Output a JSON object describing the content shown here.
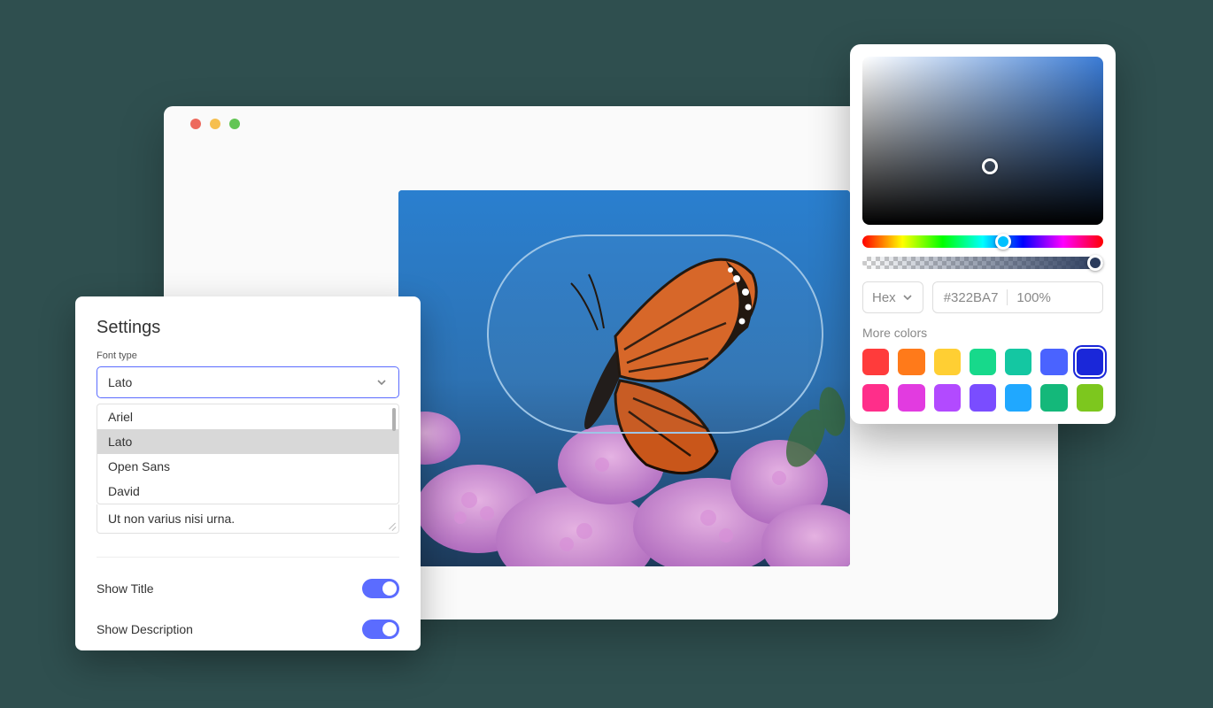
{
  "settings": {
    "title": "Settings",
    "font_label": "Font type",
    "selected_font": "Lato",
    "options": [
      "Ariel",
      "Lato",
      "Open Sans",
      "David"
    ],
    "selected_index": 1,
    "placeholder_text": "Ut non varius nisi urna.",
    "toggles": [
      {
        "label": "Show Title",
        "on": true
      },
      {
        "label": "Show Description",
        "on": true
      }
    ]
  },
  "picker": {
    "mode": "Hex",
    "hex": "#322BA7",
    "opacity": "100%",
    "more_label": "More colors",
    "swatches": [
      "#ff3b3b",
      "#ff7a1a",
      "#ffcf33",
      "#17d98b",
      "#14c7a2",
      "#4a63ff",
      "#1a27d9",
      "#ff2e8a",
      "#e23be0",
      "#b24aff",
      "#7a4dff",
      "#20a8ff",
      "#14b87a",
      "#7dc71e"
    ],
    "selected_swatch": 6
  },
  "image": {
    "alt": "Monarch butterfly on pink flowers against blue sky",
    "hotspot_shape": "pill"
  }
}
